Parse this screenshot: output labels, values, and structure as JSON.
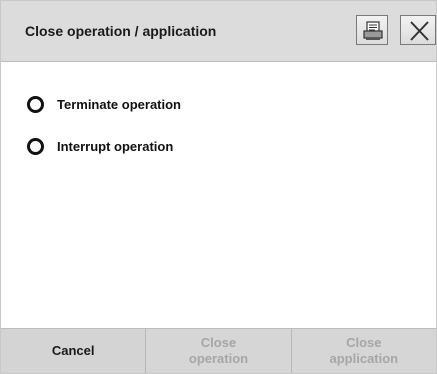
{
  "dialog": {
    "title": "Close operation / application",
    "print_icon": "printer-icon",
    "close_icon": "close-icon"
  },
  "options": [
    {
      "label": "Terminate operation",
      "selected": false
    },
    {
      "label": "Interrupt operation",
      "selected": false
    }
  ],
  "footer": {
    "cancel": "Cancel",
    "close_operation": "Close\noperation",
    "close_application": "Close\napplication"
  },
  "colors": {
    "titlebar": "#dcdcdc",
    "footer": "#d4d4d4",
    "disabled_text": "#a6a6a6"
  }
}
